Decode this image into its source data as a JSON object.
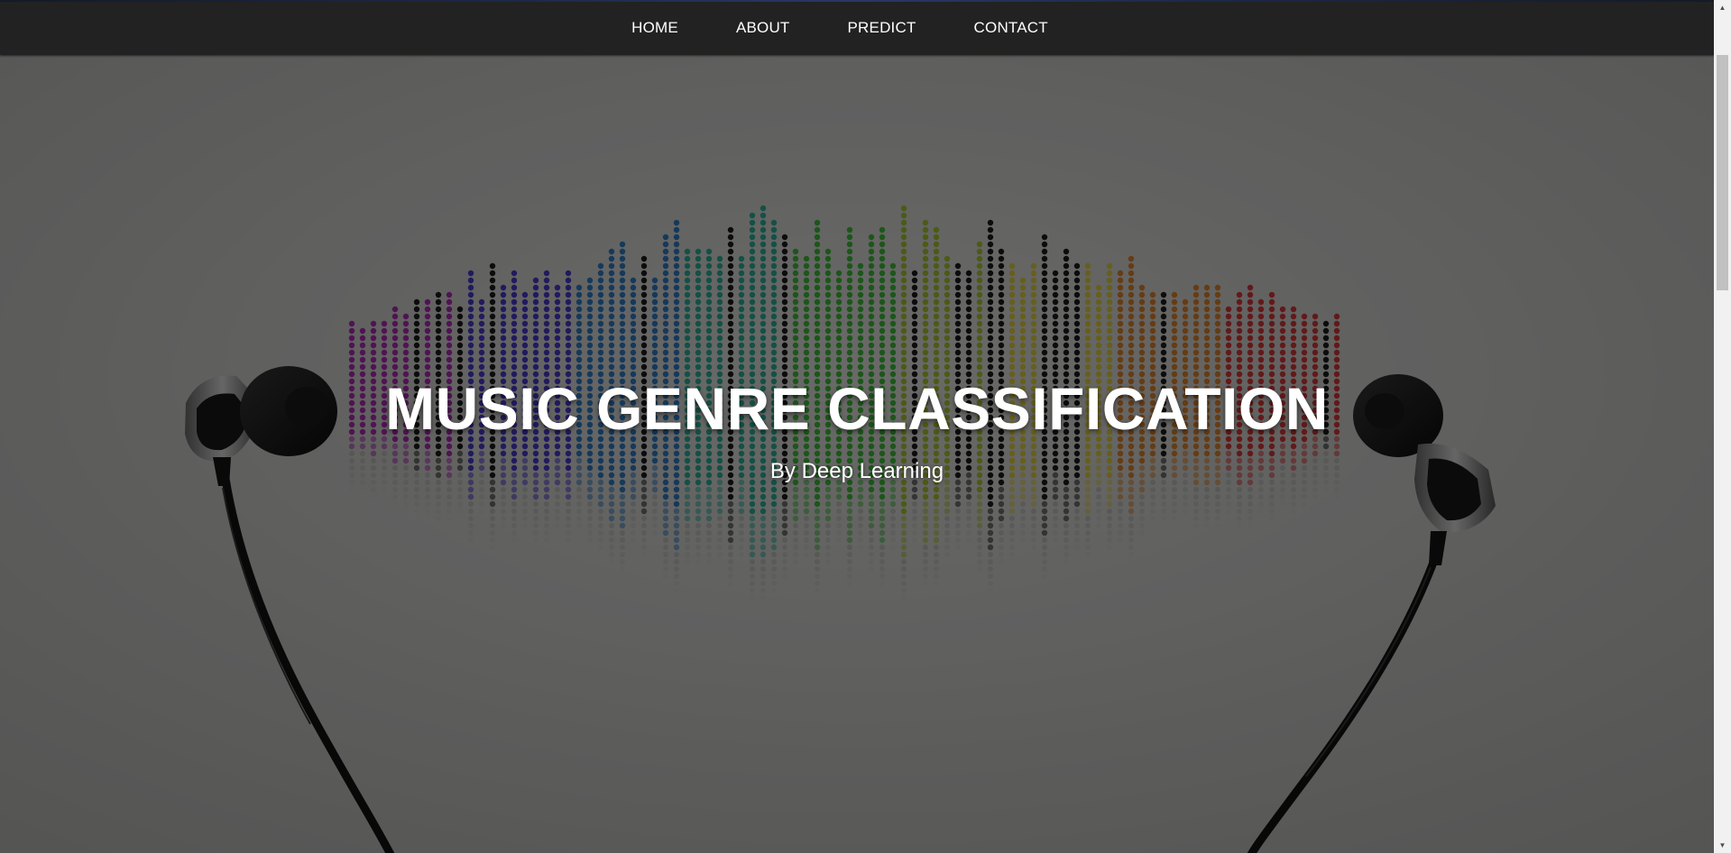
{
  "nav": {
    "items": [
      {
        "label": "HOME"
      },
      {
        "label": "ABOUT"
      },
      {
        "label": "PREDICT"
      },
      {
        "label": "CONTACT"
      }
    ]
  },
  "hero": {
    "title": "MUSIC GENRE CLASSIFICATION",
    "subtitle": "By Deep Learning",
    "background_image": "headphones-with-rainbow-sound-wave-equalizer",
    "equalizer_colors": [
      "#b12bb9",
      "#4b3bd0",
      "#2f7ec9",
      "#2ab39a",
      "#3fbf3a",
      "#a8c832",
      "#e2d23e",
      "#e0852e",
      "#d93838"
    ]
  },
  "colors": {
    "navbar": "#222222",
    "nav_text": "#ffffff",
    "overlay": "rgba(0,0,0,0.55)"
  },
  "icons": {
    "scroll_up": "triangle-up-icon",
    "scroll_down": "triangle-down-icon"
  }
}
